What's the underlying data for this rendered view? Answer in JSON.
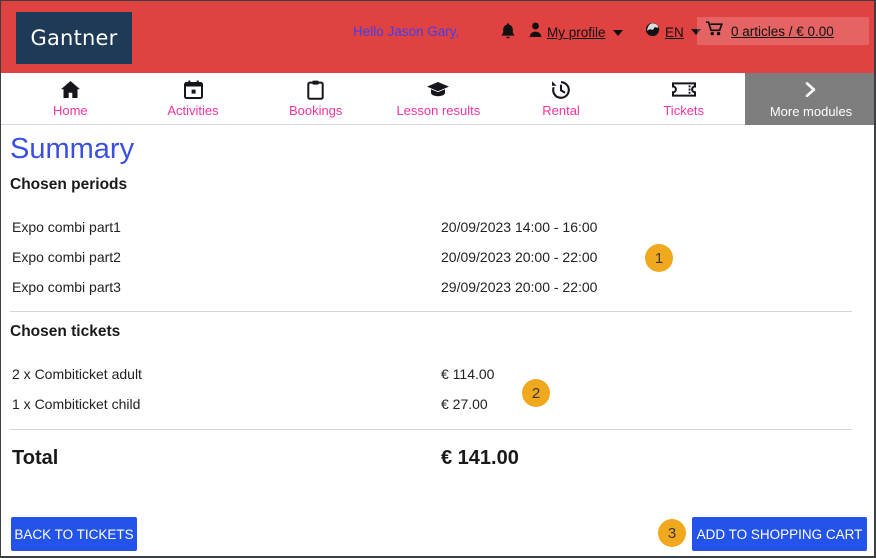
{
  "header": {
    "logo_text": "Gantner",
    "greeting": "Hello Jason Gary,",
    "bell_icon": "bell-icon",
    "profile_icon": "person-icon",
    "profile_label": "My profile",
    "globe_icon": "globe-icon",
    "language": "EN",
    "cart_icon": "shopping-cart-icon",
    "cart_label": "0 articles / € 0.00",
    "brand_red": "#e04141",
    "logo_navy": "#1e3a56"
  },
  "nav": {
    "accent_pink": "#f0339e",
    "items": [
      {
        "label": "Home",
        "icon": "home-icon"
      },
      {
        "label": "Activities",
        "icon": "calendar-icon"
      },
      {
        "label": "Bookings",
        "icon": "clipboard-icon"
      },
      {
        "label": "Lesson results",
        "icon": "graduation-cap-icon"
      },
      {
        "label": "Rental",
        "icon": "clock-history-icon"
      },
      {
        "label": "Tickets",
        "icon": "ticket-icon"
      }
    ],
    "more_modules": {
      "label": "More modules",
      "icon": "chevron-right-icon",
      "background": "#7d7d7d"
    }
  },
  "main": {
    "title": "Summary",
    "title_color": "#3b4fe0",
    "periods": {
      "heading": "Chosen periods",
      "rows": [
        {
          "name": "Expo combi part1",
          "value": "20/09/2023 14:00 - 16:00"
        },
        {
          "name": "Expo combi part2",
          "value": "20/09/2023 20:00 - 22:00"
        },
        {
          "name": "Expo combi part3",
          "value": "29/09/2023 20:00 - 22:00"
        }
      ]
    },
    "tickets": {
      "heading": "Chosen tickets",
      "rows": [
        {
          "name": "2 x Combiticket adult",
          "value": "€ 114.00"
        },
        {
          "name": "1 x Combiticket child",
          "value": "€ 27.00"
        }
      ]
    },
    "total": {
      "label": "Total",
      "value": "€ 141.00"
    }
  },
  "badges": {
    "color": "#f0a81e",
    "one": "1",
    "two": "2",
    "three": "3"
  },
  "footer": {
    "button_color": "#2353e8",
    "back_label": "BACK TO TICKETS",
    "cart_label": "ADD TO SHOPPING CART"
  }
}
